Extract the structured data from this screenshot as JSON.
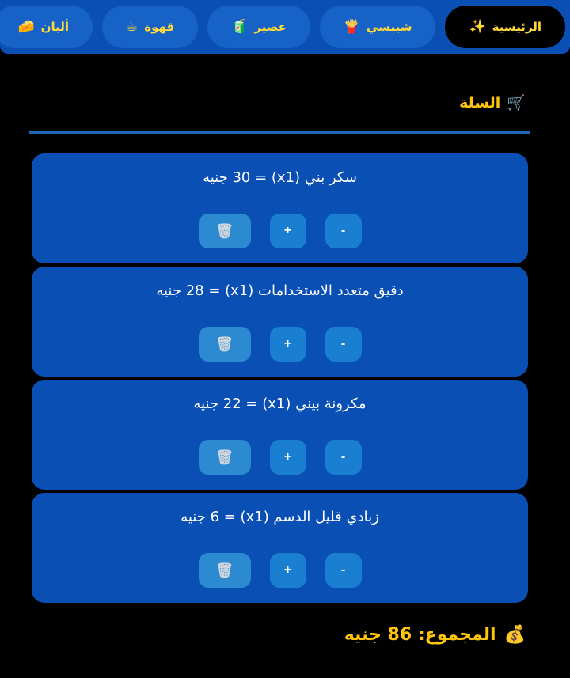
{
  "nav": {
    "tabs": [
      {
        "label": "الرئيسية",
        "icon": "✨",
        "active": true
      },
      {
        "label": "شيبسي",
        "icon": "🍟",
        "active": false
      },
      {
        "label": "عصير",
        "icon": "🧃",
        "active": false
      },
      {
        "label": "قهوة",
        "icon": "☕",
        "active": false
      },
      {
        "label": "ألبان",
        "icon": "🧀",
        "active": false
      }
    ]
  },
  "cart": {
    "icon": "🛒",
    "title": "السلة",
    "items": [
      {
        "text": "سكر بني (x1) = 30 جنيه",
        "minus": "-",
        "plus": "+",
        "delete": "🗑"
      },
      {
        "text": "دقيق متعدد الاستخدامات (x1) = 28 جنيه",
        "minus": "-",
        "plus": "+",
        "delete": "🗑"
      },
      {
        "text": "مكرونة بيني (x1) = 22 جنيه",
        "minus": "-",
        "plus": "+",
        "delete": "🗑"
      },
      {
        "text": "زبادي قليل الدسم (x1) = 6 جنيه",
        "minus": "-",
        "plus": "+",
        "delete": "🗑"
      }
    ]
  },
  "total": {
    "icon": "💰",
    "text": "المجموع: 86 جنيه"
  }
}
